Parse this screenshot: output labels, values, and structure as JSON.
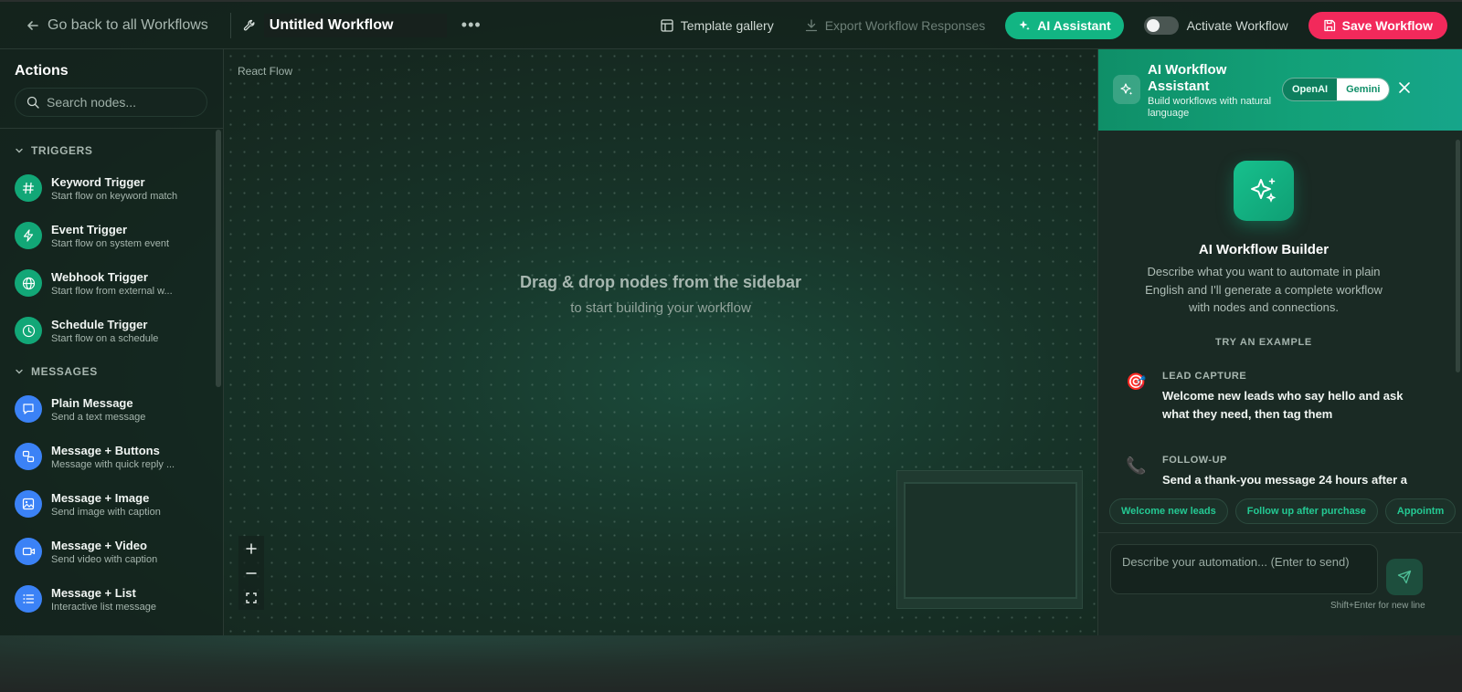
{
  "header": {
    "back_label": "Go back to all Workflows",
    "workflow_title": "Untitled Workflow",
    "more_label": "•••",
    "template_gallery": "Template gallery",
    "export_label": "Export Workflow Responses",
    "ai_assistant": "AI Assistant",
    "activate_label": "Activate Workflow",
    "save_label": "Save Workflow"
  },
  "sidebar": {
    "title": "Actions",
    "search_placeholder": "Search nodes...",
    "sections": [
      {
        "label": "TRIGGERS",
        "items": [
          {
            "name": "Keyword Trigger",
            "desc": "Start flow on keyword match",
            "icon": "hash-icon"
          },
          {
            "name": "Event Trigger",
            "desc": "Start flow on system event",
            "icon": "bolt-icon"
          },
          {
            "name": "Webhook Trigger",
            "desc": "Start flow from external w...",
            "icon": "globe-icon"
          },
          {
            "name": "Schedule Trigger",
            "desc": "Start flow on a schedule",
            "icon": "clock-icon"
          }
        ]
      },
      {
        "label": "MESSAGES",
        "items": [
          {
            "name": "Plain Message",
            "desc": "Send a text message",
            "icon": "chat-icon"
          },
          {
            "name": "Message + Buttons",
            "desc": "Message with quick reply ...",
            "icon": "buttons-icon"
          },
          {
            "name": "Message + Image",
            "desc": "Send image with caption",
            "icon": "image-icon"
          },
          {
            "name": "Message + Video",
            "desc": "Send video with caption",
            "icon": "video-icon"
          },
          {
            "name": "Message + List",
            "desc": "Interactive list message",
            "icon": "list-icon"
          }
        ]
      }
    ]
  },
  "canvas": {
    "label": "React Flow",
    "empty_title": "Drag & drop nodes from the sidebar",
    "empty_sub": "to start building your workflow"
  },
  "ai_panel": {
    "title": "AI Workflow Assistant",
    "subtitle": "Build workflows with natural language",
    "providers": [
      "OpenAI",
      "Gemini"
    ],
    "active_provider": "Gemini",
    "builder_title": "AI Workflow Builder",
    "builder_desc": "Describe what you want to automate in plain English and I'll generate a complete workflow with nodes and connections.",
    "try_label": "TRY AN EXAMPLE",
    "examples": [
      {
        "label": "LEAD CAPTURE",
        "text": "Welcome new leads who say hello and ask what they need, then tag them",
        "emoji": "🎯"
      },
      {
        "label": "FOLLOW-UP",
        "text": "Send a thank-you message 24 hours after a",
        "emoji": "📞"
      }
    ],
    "chips": [
      "Welcome new leads",
      "Follow up after purchase",
      "Appointm"
    ],
    "input_placeholder": "Describe your automation... (Enter to send)",
    "hint": "Shift+Enter for new line"
  },
  "colors": {
    "accent": "#12b583",
    "save": "#f2295b",
    "trigger_icon": "#12a777",
    "message_icon": "#3b82f6"
  }
}
